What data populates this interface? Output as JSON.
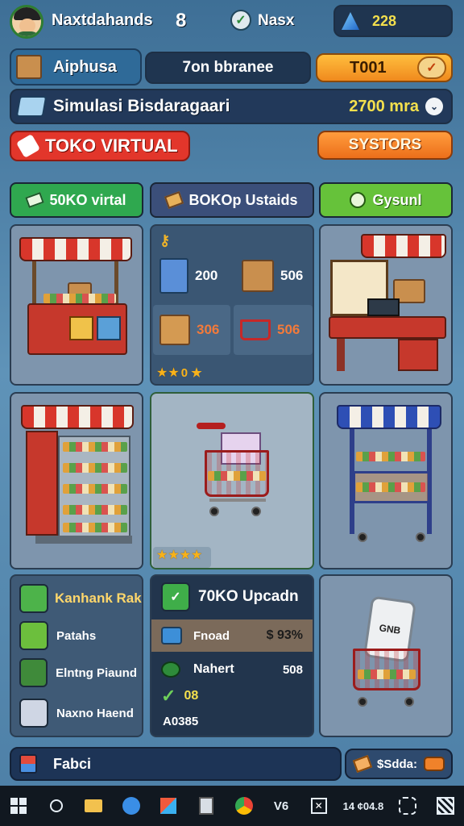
{
  "top_bar": {
    "player_name": "Naxtdahands",
    "level": "8",
    "task_label": "Nasx",
    "gems": "228"
  },
  "row2": {
    "store_name": "Aiphusa",
    "center_label": "7on bbranee",
    "gold_button": "T001"
  },
  "row3": {
    "simulation_title": "Simulasi Bisdaragaari",
    "money": "2700 mra"
  },
  "row4": {
    "banner": "TOKO VIRTUAL",
    "systems_button": "SYSTORS"
  },
  "tabs": [
    {
      "label": "50KO virtal"
    },
    {
      "label": "BOKOp Ustaids"
    },
    {
      "label": "Gysunl"
    }
  ],
  "inventory": {
    "items": [
      {
        "value": "200"
      },
      {
        "value": "506"
      },
      {
        "value": "306"
      },
      {
        "value": "506"
      }
    ],
    "rating_stars": "★★",
    "rating_text": "0 ★"
  },
  "cart_rating": "★★★★",
  "bottom_left": {
    "title": "Kanhank Rak",
    "items": [
      "Patahs",
      "Elntng Piaund",
      "Naxno Haend"
    ]
  },
  "bottom_mid": {
    "title": "70KO Upcadn",
    "row1_label": "Fnoad",
    "row1_value": "$ 93%",
    "row2_label": "Nahert",
    "row2_value": "508",
    "row3_value": "08",
    "footer": "A0385"
  },
  "bottom_right": {
    "tag": "GNB"
  },
  "footer_bar": {
    "left_label": "Fabci",
    "right_label": "$Sdda:"
  },
  "taskbar": {
    "text_v6": "V6",
    "clock": "14 ¢04.8"
  },
  "colors": {
    "green_tab": "#2fa84f",
    "blue_tab": "#3b4f7a",
    "lime_tab": "#66c23a",
    "orange": "#f0822a",
    "red_banner": "#e2362b"
  }
}
